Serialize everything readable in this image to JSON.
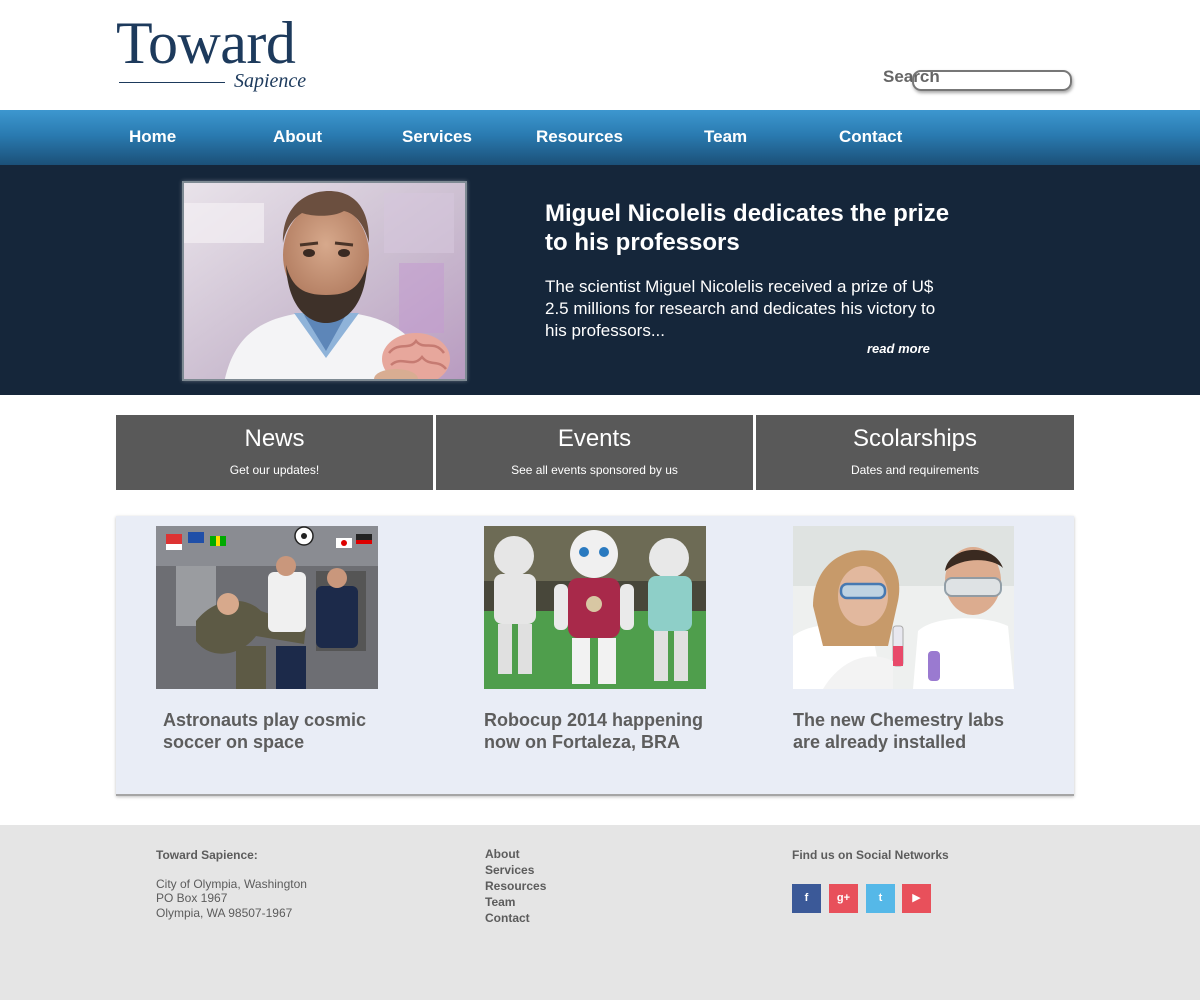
{
  "brand": {
    "name": "Toward",
    "tagline": "Sapience"
  },
  "search": {
    "label": "Search",
    "value": "",
    "placeholder": ""
  },
  "nav": {
    "items": [
      {
        "label": "Home"
      },
      {
        "label": "About"
      },
      {
        "label": "Services"
      },
      {
        "label": "Resources"
      },
      {
        "label": "Team"
      },
      {
        "label": "Contact"
      }
    ]
  },
  "hero": {
    "title": "Miguel Nicolelis dedicates the prize to his professors",
    "body": "The scientist Miguel Nicolelis received a prize of U$ 2.5 millions for research and dedicates his victory to his professors...",
    "read_more": "read more"
  },
  "features": [
    {
      "title": "News",
      "subtitle": "Get our updates!"
    },
    {
      "title": "Events",
      "subtitle": "See all events sponsored by us"
    },
    {
      "title": "Scolarships",
      "subtitle": "Dates and requirements"
    }
  ],
  "articles": [
    {
      "title": "Astronauts play cosmic soccer on space"
    },
    {
      "title": "Robocup 2014 happening now on Fortaleza, BRA"
    },
    {
      "title": "The new Chemestry labs are already installed"
    }
  ],
  "footer": {
    "org_heading": "Toward Sapience:",
    "address": [
      "City of Olympia, Washington",
      "PO Box 1967",
      "Olympia, WA 98507-1967"
    ],
    "links": [
      "About",
      "Services",
      "Resources",
      "Team",
      "Contact"
    ],
    "social_heading": "Find us on Social Networks",
    "social": [
      {
        "icon": "facebook-icon",
        "glyph": "f",
        "color": "#3b5998"
      },
      {
        "icon": "google-plus-icon",
        "glyph": "g+",
        "color": "#e8505b"
      },
      {
        "icon": "twitter-icon",
        "glyph": "t",
        "color": "#55b8e8"
      },
      {
        "icon": "youtube-icon",
        "glyph": "▶",
        "color": "#e8505b"
      }
    ]
  },
  "colors": {
    "brand": "#1d3a5c",
    "nav_top": "#3d97cf",
    "nav_bottom": "#1b5078",
    "hero_bg": "#15263a",
    "feature_bg": "#595959",
    "panel_bg": "#e9edf6",
    "footer_bg": "#e5e5e5"
  }
}
